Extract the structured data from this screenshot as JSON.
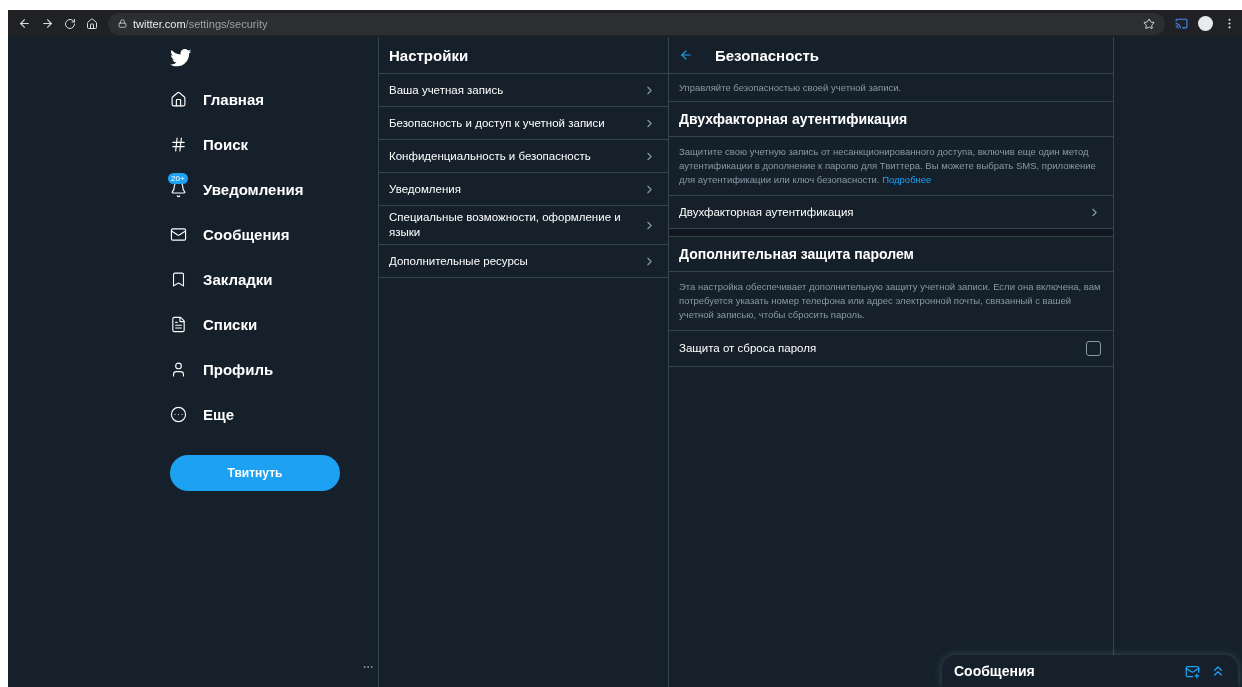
{
  "browser": {
    "url_host": "twitter.com",
    "url_path": "/settings/security"
  },
  "nav": {
    "items": [
      {
        "kind": "home",
        "label": "Главная"
      },
      {
        "kind": "search",
        "label": "Поиск"
      },
      {
        "kind": "bell",
        "label": "Уведомления",
        "badge": "20+"
      },
      {
        "kind": "mail",
        "label": "Сообщения"
      },
      {
        "kind": "bookmark",
        "label": "Закладки"
      },
      {
        "kind": "list",
        "label": "Списки"
      },
      {
        "kind": "user",
        "label": "Профиль"
      },
      {
        "kind": "more",
        "label": "Еще"
      }
    ],
    "tweet_button": "Твитнуть"
  },
  "settings": {
    "title": "Настройки",
    "items": [
      {
        "label": "Ваша учетная запись"
      },
      {
        "label": "Безопасность и доступ к учетной записи"
      },
      {
        "label": "Конфиденциальность и безопасность"
      },
      {
        "label": "Уведомления"
      },
      {
        "label": "Специальные возможности, оформление и языки"
      },
      {
        "label": "Дополнительные ресурсы"
      }
    ]
  },
  "detail": {
    "title": "Безопасность",
    "subtitle": "Управляйте безопасностью своей учетной записи.",
    "sections": [
      {
        "heading": "Двухфакторная аутентификация",
        "text": "Защитите свою учетную запись от несанкционированного доступа, включив еще один метод аутентификации в дополнение к паролю для Твиттера. Вы можете выбрать SMS, приложение для аутентификации или ключ безопасности.",
        "link": "Подробнее",
        "row": {
          "kind": "link",
          "label": "Двухфакторная аутентификация"
        }
      },
      {
        "heading": "Дополнительная защита паролем",
        "text": "Эта настройка обеспечивает дополнительную защиту учетной записи. Если она включена, вам потребуется указать номер телефона или адрес электронной почты, связанный с вашей учетной записью, чтобы сбросить пароль.",
        "row": {
          "kind": "checkbox",
          "label": "Защита от сброса пароля",
          "checked": false
        }
      }
    ]
  },
  "messages_dock": {
    "title": "Сообщения"
  }
}
